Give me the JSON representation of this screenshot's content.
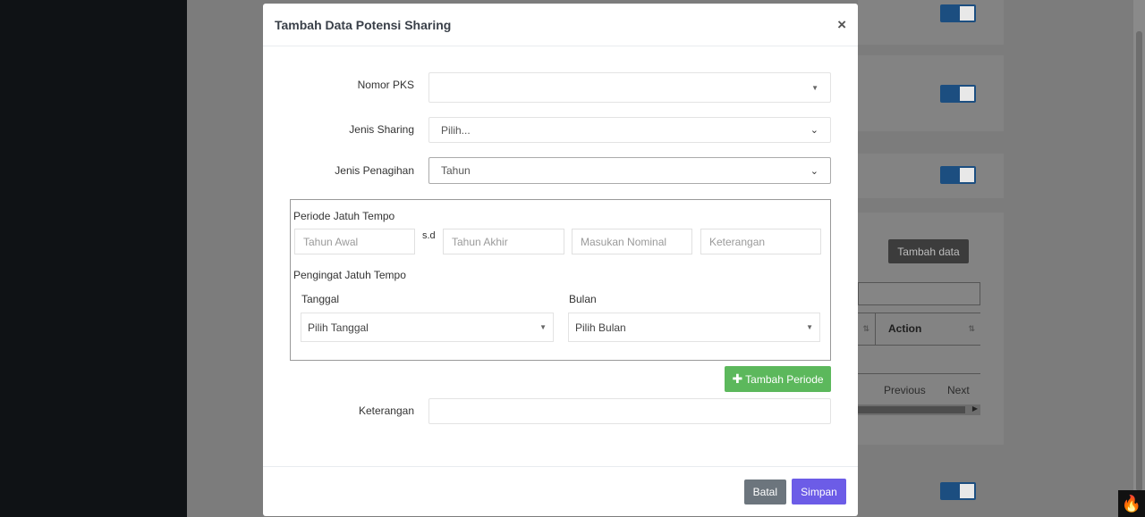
{
  "background": {
    "tambah_data_label": "Tambah data",
    "action_header": "Action",
    "previous_label": "Previous",
    "next_label": "Next"
  },
  "modal": {
    "title": "Tambah Data Potensi Sharing",
    "close_symbol": "×",
    "nomor_pks": {
      "label": "Nomor PKS",
      "value": ""
    },
    "jenis_sharing": {
      "label": "Jenis Sharing",
      "value": "Pilih..."
    },
    "jenis_penagihan": {
      "label": "Jenis Penagihan",
      "value": "Tahun"
    },
    "periode": {
      "title": "Periode Jatuh Tempo",
      "separator": "s.d",
      "tahun_awal_placeholder": "Tahun Awal",
      "tahun_akhir_placeholder": "Tahun Akhir",
      "nominal_placeholder": "Masukan Nominal",
      "keterangan_placeholder": "Keterangan",
      "pengingat_title": "Pengingat Jatuh Tempo",
      "tanggal_label": "Tanggal",
      "tanggal_value": "Pilih Tanggal",
      "bulan_label": "Bulan",
      "bulan_value": "Pilih Bulan"
    },
    "tambah_periode_label": "Tambah Periode",
    "keterangan": {
      "label": "Keterangan",
      "value": ""
    },
    "batal_label": "Batal",
    "simpan_label": "Simpan"
  },
  "colors": {
    "primary": "#6c5ce7",
    "success": "#5cb85c",
    "secondary": "#6c757d",
    "toggle": "#1c4e80"
  }
}
